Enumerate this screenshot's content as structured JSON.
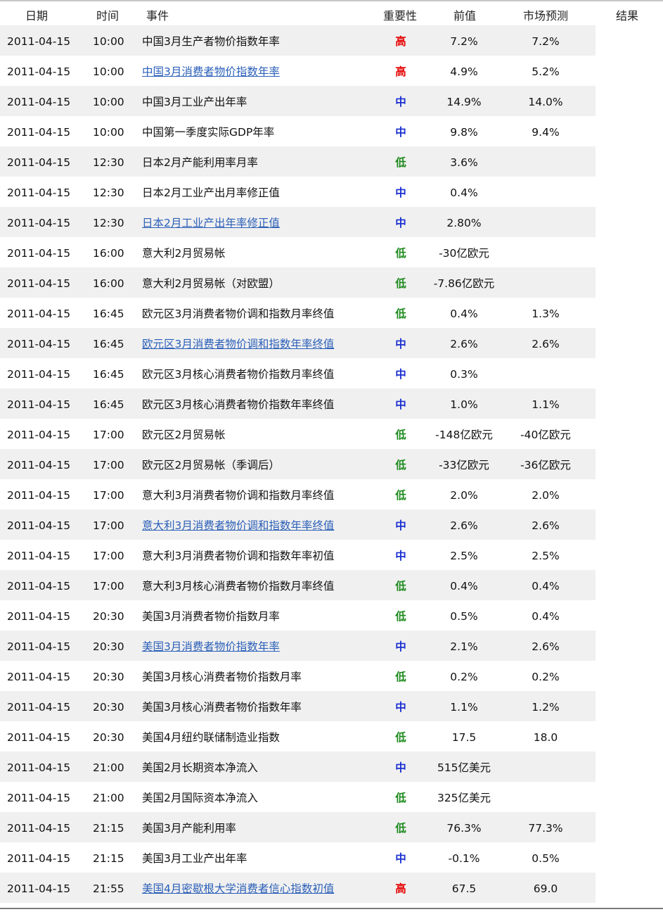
{
  "colors": {
    "high": "#e60000",
    "mid": "#1a2fd0",
    "low": "#1c8a1c",
    "link": "#2b5fb8",
    "row_alt_bg": "#f0f0f0"
  },
  "header": {
    "date": "日期",
    "time": "时间",
    "event": "事件",
    "importance": "重要性",
    "previous": "前值",
    "forecast": "市场预测",
    "result": "结果"
  },
  "rows": [
    {
      "date": "2011-04-15",
      "time": "10:00",
      "event": "中国3月生产者物价指数年率",
      "link": false,
      "importance": "高",
      "level": "high",
      "previous": "7.2%",
      "forecast": "7.2%",
      "result": ""
    },
    {
      "date": "2011-04-15",
      "time": "10:00",
      "event": "中国3月消费者物价指数年率",
      "link": true,
      "importance": "高",
      "level": "high",
      "previous": "4.9%",
      "forecast": "5.2%",
      "result": ""
    },
    {
      "date": "2011-04-15",
      "time": "10:00",
      "event": "中国3月工业产出年率",
      "link": false,
      "importance": "中",
      "level": "mid",
      "previous": "14.9%",
      "forecast": "14.0%",
      "result": ""
    },
    {
      "date": "2011-04-15",
      "time": "10:00",
      "event": "中国第一季度实际GDP年率",
      "link": false,
      "importance": "中",
      "level": "mid",
      "previous": "9.8%",
      "forecast": "9.4%",
      "result": ""
    },
    {
      "date": "2011-04-15",
      "time": "12:30",
      "event": "日本2月产能利用率月率",
      "link": false,
      "importance": "低",
      "level": "low",
      "previous": "3.6%",
      "forecast": "",
      "result": ""
    },
    {
      "date": "2011-04-15",
      "time": "12:30",
      "event": "日本2月工业产出月率修正值",
      "link": false,
      "importance": "中",
      "level": "mid",
      "previous": "0.4%",
      "forecast": "",
      "result": ""
    },
    {
      "date": "2011-04-15",
      "time": "12:30",
      "event": "日本2月工业产出年率修正值",
      "link": true,
      "importance": "中",
      "level": "mid",
      "previous": "2.80%",
      "forecast": "",
      "result": ""
    },
    {
      "date": "2011-04-15",
      "time": "16:00",
      "event": "意大利2月贸易帐",
      "link": false,
      "importance": "低",
      "level": "low",
      "previous": "-30亿欧元",
      "forecast": "",
      "result": ""
    },
    {
      "date": "2011-04-15",
      "time": "16:00",
      "event": "意大利2月贸易帐（对欧盟）",
      "link": false,
      "importance": "低",
      "level": "low",
      "previous": "-7.86亿欧元",
      "forecast": "",
      "result": ""
    },
    {
      "date": "2011-04-15",
      "time": "16:45",
      "event": "欧元区3月消费者物价调和指数月率终值",
      "link": false,
      "importance": "低",
      "level": "low",
      "previous": "0.4%",
      "forecast": "1.3%",
      "result": ""
    },
    {
      "date": "2011-04-15",
      "time": "16:45",
      "event": "欧元区3月消费者物价调和指数年率终值",
      "link": true,
      "importance": "中",
      "level": "mid",
      "previous": "2.6%",
      "forecast": "2.6%",
      "result": ""
    },
    {
      "date": "2011-04-15",
      "time": "16:45",
      "event": "欧元区3月核心消费者物价指数月率终值",
      "link": false,
      "importance": "中",
      "level": "mid",
      "previous": "0.3%",
      "forecast": "",
      "result": ""
    },
    {
      "date": "2011-04-15",
      "time": "16:45",
      "event": "欧元区3月核心消费者物价指数年率终值",
      "link": false,
      "importance": "中",
      "level": "mid",
      "previous": "1.0%",
      "forecast": "1.1%",
      "result": ""
    },
    {
      "date": "2011-04-15",
      "time": "17:00",
      "event": "欧元区2月贸易帐",
      "link": false,
      "importance": "低",
      "level": "low",
      "previous": "-148亿欧元",
      "forecast": "-40亿欧元",
      "result": ""
    },
    {
      "date": "2011-04-15",
      "time": "17:00",
      "event": "欧元区2月贸易帐（季调后）",
      "link": false,
      "importance": "低",
      "level": "low",
      "previous": "-33亿欧元",
      "forecast": "-36亿欧元",
      "result": ""
    },
    {
      "date": "2011-04-15",
      "time": "17:00",
      "event": "意大利3月消费者物价调和指数月率终值",
      "link": false,
      "importance": "低",
      "level": "low",
      "previous": "2.0%",
      "forecast": "2.0%",
      "result": ""
    },
    {
      "date": "2011-04-15",
      "time": "17:00",
      "event": "意大利3月消费者物价调和指数年率终值",
      "link": true,
      "importance": "中",
      "level": "mid",
      "previous": "2.6%",
      "forecast": "2.6%",
      "result": ""
    },
    {
      "date": "2011-04-15",
      "time": "17:00",
      "event": "意大利3月消费者物价调和指数年率初值",
      "link": false,
      "importance": "中",
      "level": "mid",
      "previous": "2.5%",
      "forecast": "2.5%",
      "result": ""
    },
    {
      "date": "2011-04-15",
      "time": "17:00",
      "event": "意大利3月核心消费者物价指数月率终值",
      "link": false,
      "importance": "低",
      "level": "low",
      "previous": "0.4%",
      "forecast": "0.4%",
      "result": ""
    },
    {
      "date": "2011-04-15",
      "time": "20:30",
      "event": "美国3月消费者物价指数月率",
      "link": false,
      "importance": "低",
      "level": "low",
      "previous": "0.5%",
      "forecast": "0.4%",
      "result": ""
    },
    {
      "date": "2011-04-15",
      "time": "20:30",
      "event": "美国3月消费者物价指数年率",
      "link": true,
      "importance": "中",
      "level": "mid",
      "previous": "2.1%",
      "forecast": "2.6%",
      "result": ""
    },
    {
      "date": "2011-04-15",
      "time": "20:30",
      "event": "美国3月核心消费者物价指数月率",
      "link": false,
      "importance": "低",
      "level": "low",
      "previous": "0.2%",
      "forecast": "0.2%",
      "result": ""
    },
    {
      "date": "2011-04-15",
      "time": "20:30",
      "event": "美国3月核心消费者物价指数年率",
      "link": false,
      "importance": "中",
      "level": "mid",
      "previous": "1.1%",
      "forecast": "1.2%",
      "result": ""
    },
    {
      "date": "2011-04-15",
      "time": "20:30",
      "event": "美国4月纽约联储制造业指数",
      "link": false,
      "importance": "低",
      "level": "low",
      "previous": "17.5",
      "forecast": "18.0",
      "result": ""
    },
    {
      "date": "2011-04-15",
      "time": "21:00",
      "event": "美国2月长期资本净流入",
      "link": false,
      "importance": "中",
      "level": "mid",
      "previous": "515亿美元",
      "forecast": "",
      "result": ""
    },
    {
      "date": "2011-04-15",
      "time": "21:00",
      "event": "美国2月国际资本净流入",
      "link": false,
      "importance": "低",
      "level": "low",
      "previous": "325亿美元",
      "forecast": "",
      "result": ""
    },
    {
      "date": "2011-04-15",
      "time": "21:15",
      "event": "美国3月产能利用率",
      "link": false,
      "importance": "低",
      "level": "low",
      "previous": "76.3%",
      "forecast": "77.3%",
      "result": ""
    },
    {
      "date": "2011-04-15",
      "time": "21:15",
      "event": "美国3月工业产出年率",
      "link": false,
      "importance": "中",
      "level": "mid",
      "previous": "-0.1%",
      "forecast": "0.5%",
      "result": ""
    },
    {
      "date": "2011-04-15",
      "time": "21:55",
      "event": "美国4月密歇根大学消费者信心指数初值",
      "link": true,
      "importance": "高",
      "level": "high",
      "previous": "67.5",
      "forecast": "69.0",
      "result": ""
    }
  ]
}
